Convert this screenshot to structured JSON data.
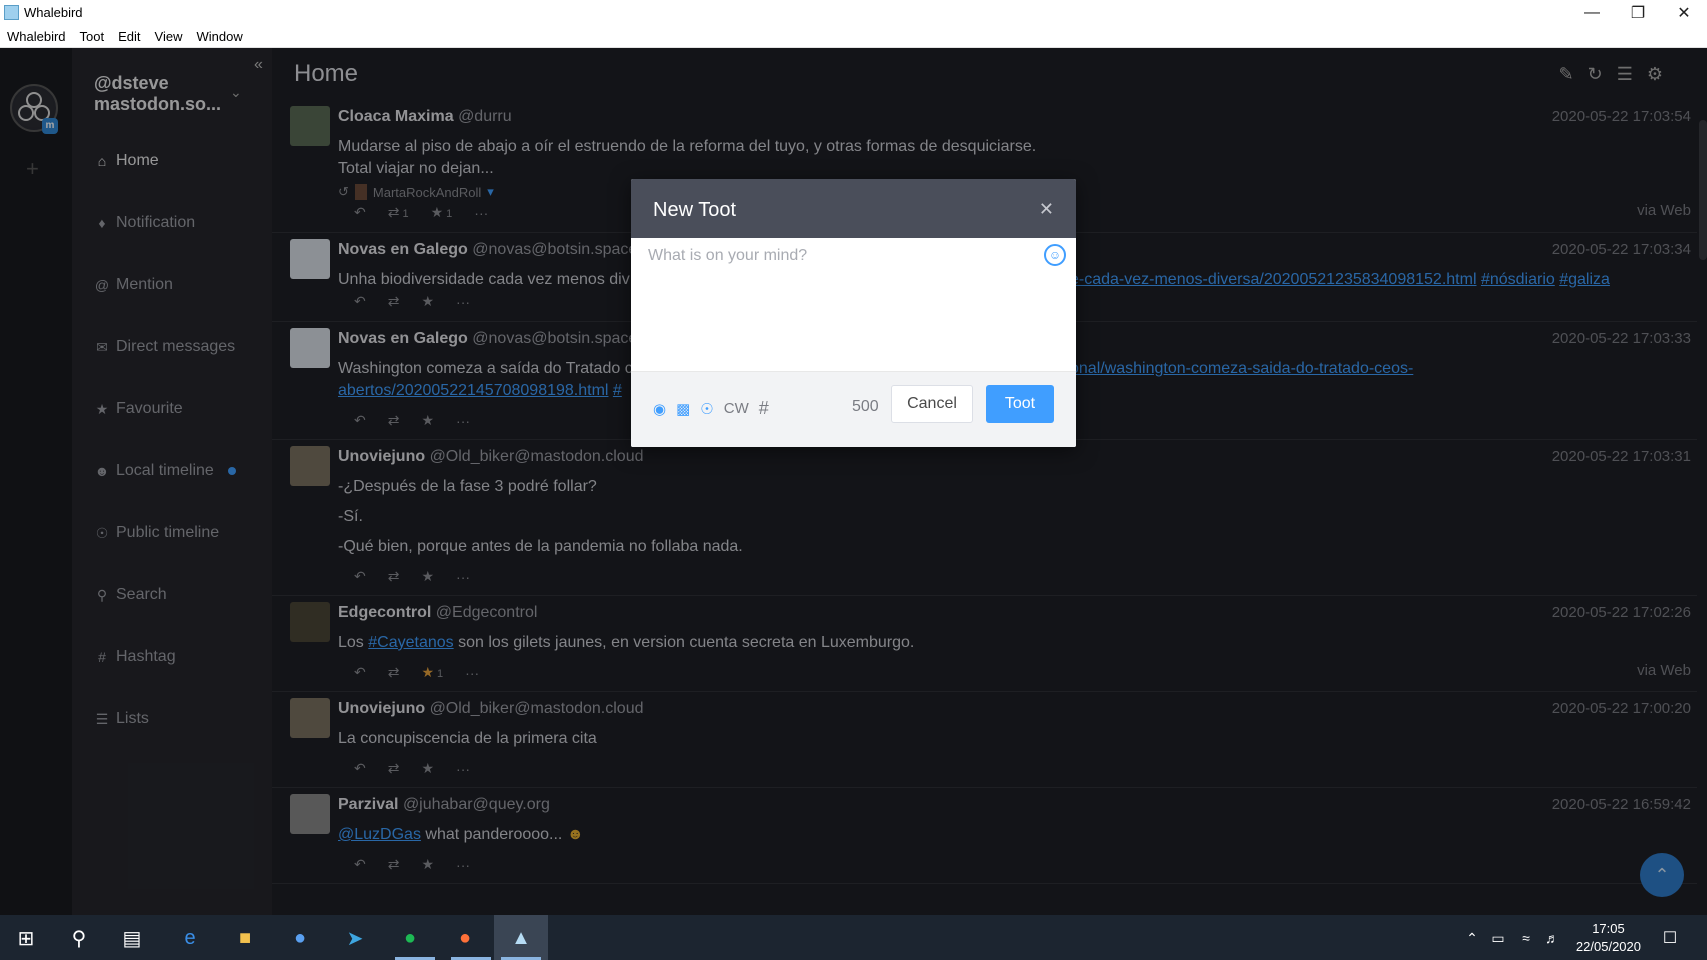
{
  "window": {
    "title": "Whalebird"
  },
  "menu": [
    "Whalebird",
    "Toot",
    "Edit",
    "View",
    "Window"
  ],
  "account": {
    "name": "@dsteve",
    "host": "mastodon.so..."
  },
  "nav": [
    {
      "label": "Home",
      "icon": "home-icon"
    },
    {
      "label": "Notification",
      "icon": "bell-icon"
    },
    {
      "label": "Mention",
      "icon": "at-icon"
    },
    {
      "label": "Direct messages",
      "icon": "envelope-icon"
    },
    {
      "label": "Favourite",
      "icon": "star-icon"
    },
    {
      "label": "Local timeline",
      "icon": "users-icon"
    },
    {
      "label": "Public timeline",
      "icon": "globe-icon"
    },
    {
      "label": "Search",
      "icon": "search-icon"
    },
    {
      "label": "Hashtag",
      "icon": "hash-icon"
    },
    {
      "label": "Lists",
      "icon": "list-icon"
    }
  ],
  "page": {
    "title": "Home"
  },
  "toots": [
    {
      "name": "Cloaca Maxima",
      "handle": "@durru",
      "time": "2020-05-22 17:03:54",
      "text1": "Mudarse al piso de abajo a oír el estruendo de la reforma del tuyo, y otras formas de desquiciarse.",
      "text2": "Total viajar no dejan...",
      "boosted_by": "MartaRockAndRoll",
      "via": "via Web",
      "reblogs": "1",
      "favs": "1"
    },
    {
      "name": "Novas en Galego",
      "handle": "@novas@botsin.space",
      "time": "2020-05-22 17:03:34",
      "text": "Unha biodiversidade cada vez menos div",
      "link": "e-cada-vez-menos-diversa/20200521235834098152.html",
      "tag1": "#nósdiario",
      "tag2": "#galiza"
    },
    {
      "name": "Novas en Galego",
      "handle": "@novas@botsin.space",
      "time": "2020-05-22 17:03:33",
      "text": "Washington comeza a saída do Tratado c",
      "link": "onal/washington-comeza-saida-do-tratado-ceos-",
      "link2": "abertos/20200522145708098198.html",
      "link2b": "#"
    },
    {
      "name": "Unoviejuno",
      "handle": "@Old_biker@mastodon.cloud",
      "time": "2020-05-22 17:03:31",
      "line1": "-¿Después de la fase 3 podré follar?",
      "line2": "-Sí.",
      "line3": "-Qué bien, porque antes de la pandemia no follaba nada."
    },
    {
      "name": "Edgecontrol",
      "handle": "@Edgecontrol",
      "time": "2020-05-22 17:02:26",
      "pre": "Los ",
      "tag": "#Cayetanos",
      "post": " son los gilets jaunes, en version cuenta secreta en Luxemburgo.",
      "via": "via Web",
      "favs": "1"
    },
    {
      "name": "Unoviejuno",
      "handle": "@Old_biker@mastodon.cloud",
      "time": "2020-05-22 17:00:20",
      "text": "La concupiscencia de la primera cita"
    },
    {
      "name": "Parzival",
      "handle": "@juhabar@quey.org",
      "time": "2020-05-22 16:59:42",
      "mention": "@LuzDGas",
      "text": " what panderoooo..."
    }
  ],
  "modal": {
    "title": "New Toot",
    "placeholder": "What is on your mind?",
    "cw": "CW",
    "count": "500",
    "cancel": "Cancel",
    "submit": "Toot"
  },
  "taskbar": {
    "time": "17:05",
    "date": "22/05/2020"
  },
  "colors": {
    "accent": "#409eff",
    "bg": "#1e1f25",
    "sidebar": "#25262c",
    "modal_head": "#4a4e5a"
  }
}
